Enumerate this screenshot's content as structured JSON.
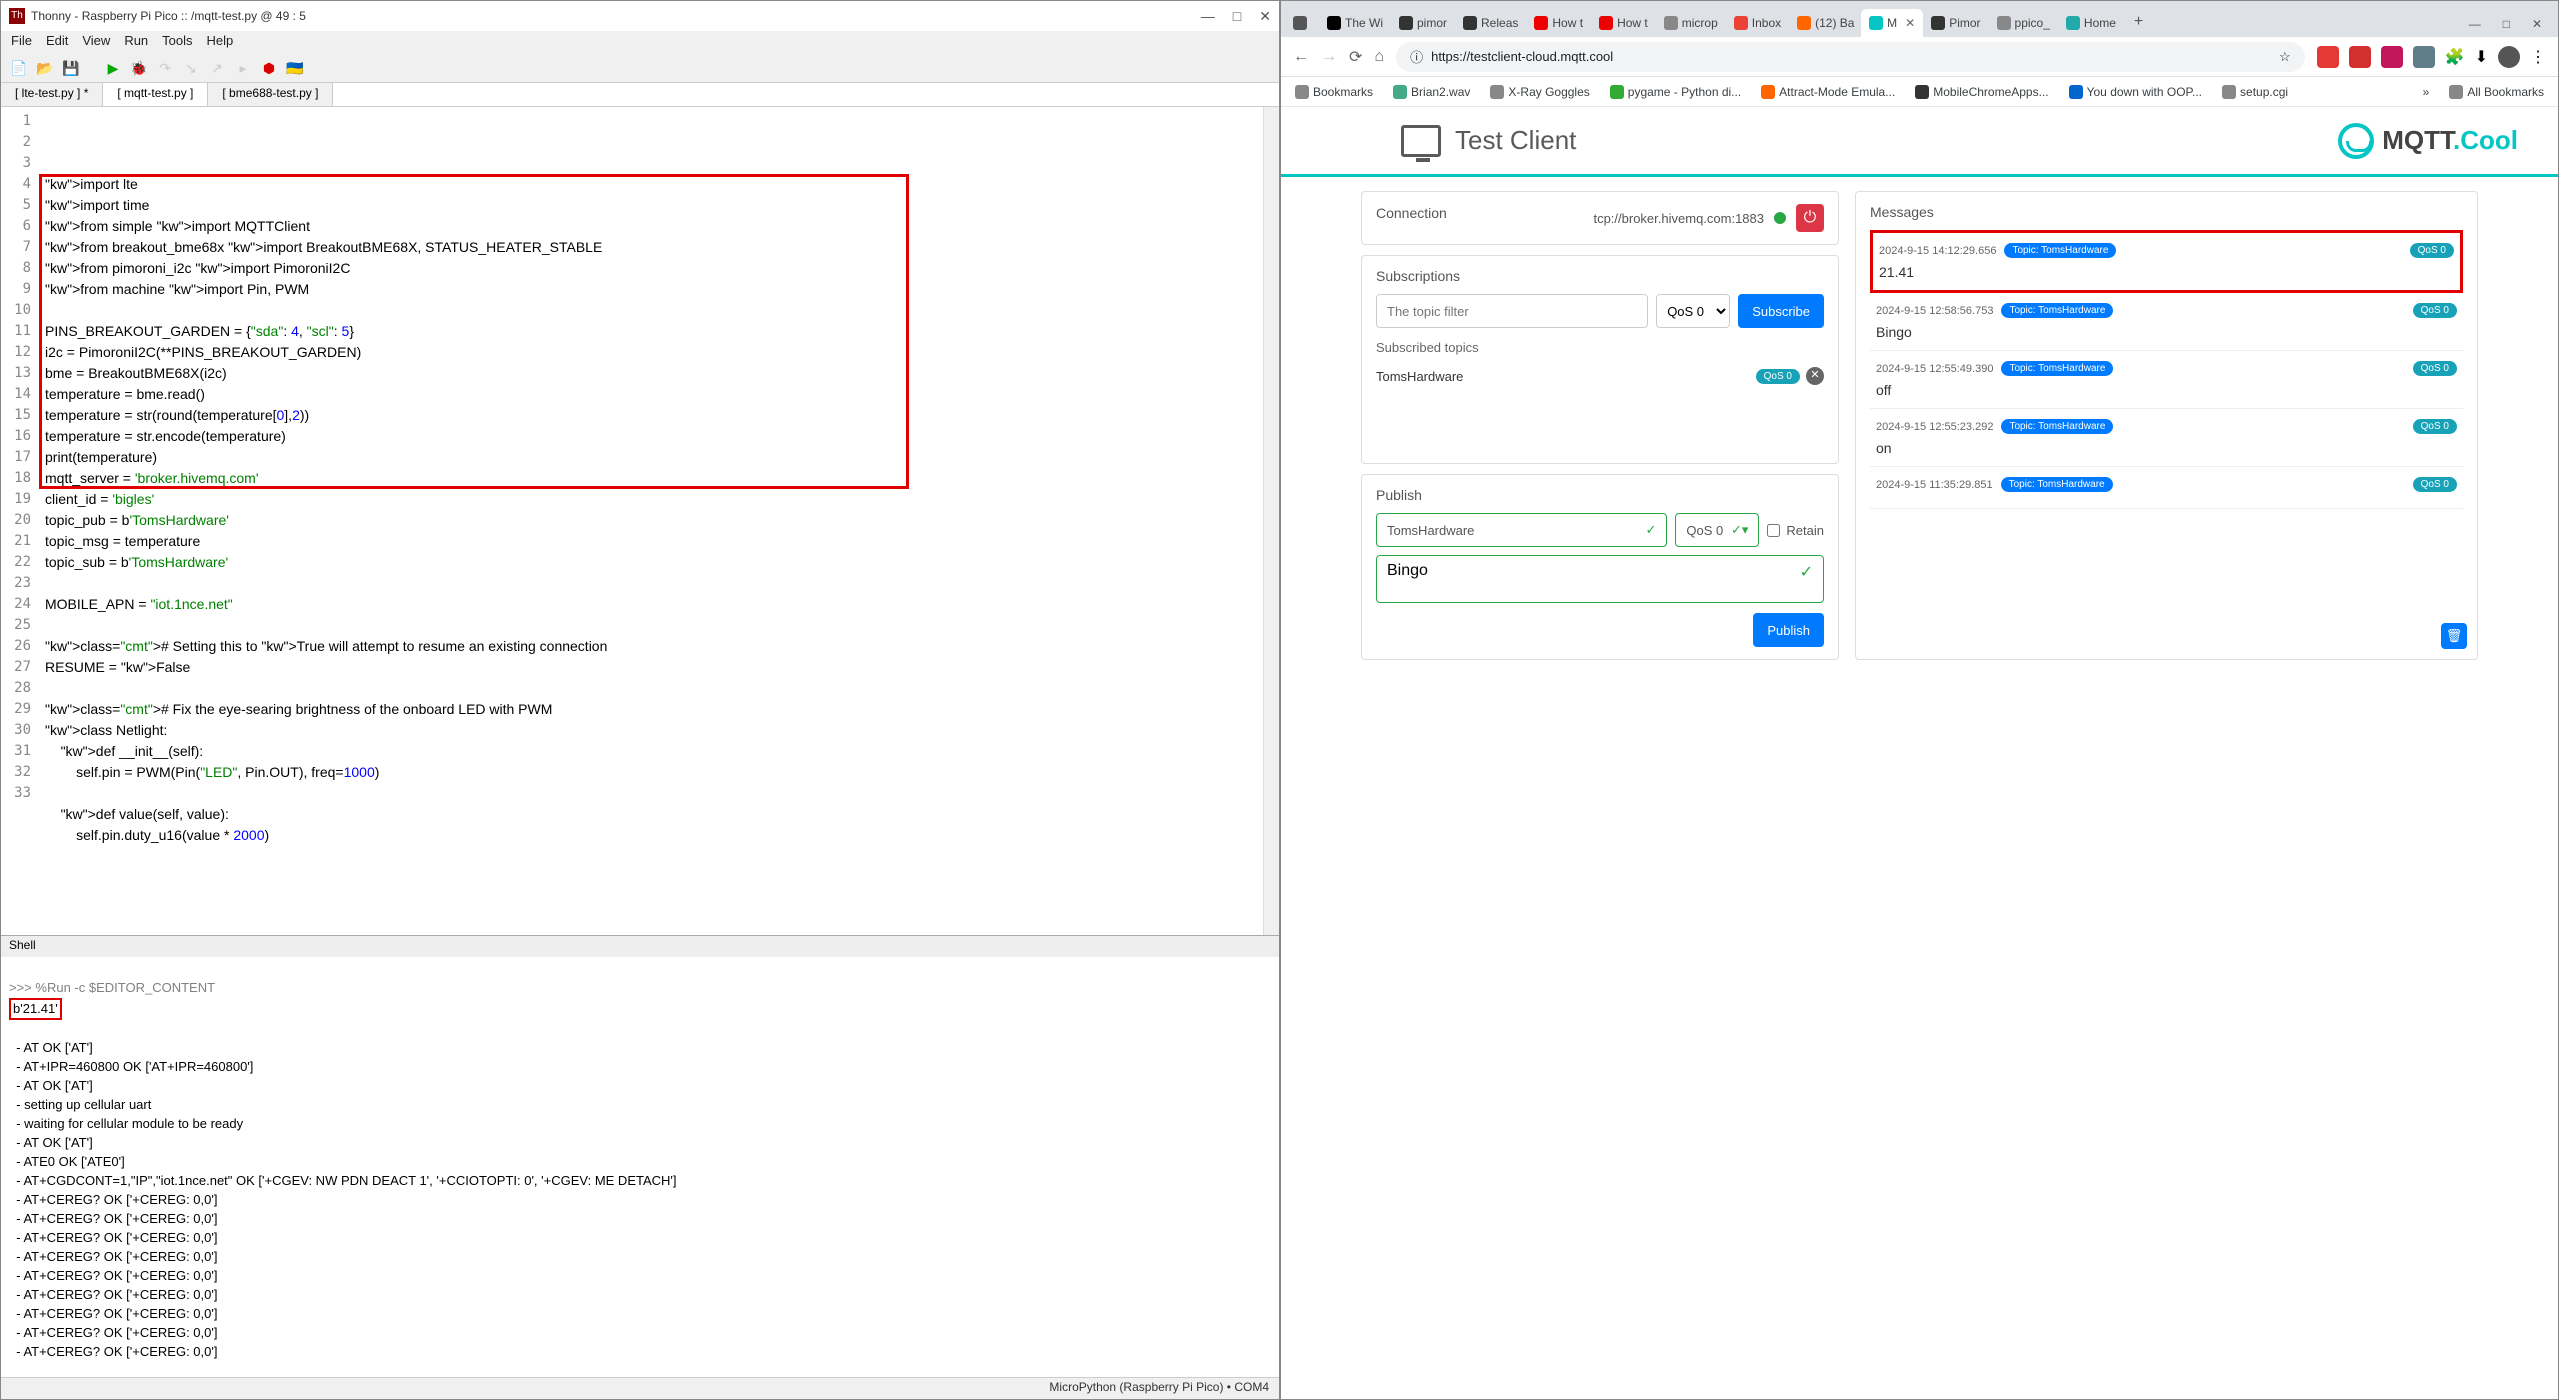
{
  "thonny": {
    "title": "Thonny  -  Raspberry Pi Pico :: /mqtt-test.py  @  49 : 5",
    "menu": [
      "File",
      "Edit",
      "View",
      "Run",
      "Tools",
      "Help"
    ],
    "tabs": [
      "[ lte-test.py ] *",
      "[ mqtt-test.py ]",
      "[ bme688-test.py ]"
    ],
    "active_tab": 1,
    "code_lines": [
      {
        "n": 1,
        "raw": "import lte"
      },
      {
        "n": 2,
        "raw": "import time"
      },
      {
        "n": 3,
        "raw": "from simple import MQTTClient"
      },
      {
        "n": 4,
        "raw": "from breakout_bme68x import BreakoutBME68X, STATUS_HEATER_STABLE"
      },
      {
        "n": 5,
        "raw": "from pimoroni_i2c import PimoroniI2C"
      },
      {
        "n": 6,
        "raw": "from machine import Pin, PWM"
      },
      {
        "n": 7,
        "raw": ""
      },
      {
        "n": 8,
        "raw": "PINS_BREAKOUT_GARDEN = {\"sda\": 4, \"scl\": 5}"
      },
      {
        "n": 9,
        "raw": "i2c = PimoroniI2C(**PINS_BREAKOUT_GARDEN)"
      },
      {
        "n": 10,
        "raw": "bme = BreakoutBME68X(i2c)"
      },
      {
        "n": 11,
        "raw": "temperature = bme.read()"
      },
      {
        "n": 12,
        "raw": "temperature = str(round(temperature[0],2))"
      },
      {
        "n": 13,
        "raw": "temperature = str.encode(temperature)"
      },
      {
        "n": 14,
        "raw": "print(temperature)"
      },
      {
        "n": 15,
        "raw": "mqtt_server = 'broker.hivemq.com'"
      },
      {
        "n": 16,
        "raw": "client_id = 'bigles'"
      },
      {
        "n": 17,
        "raw": "topic_pub = b'TomsHardware'"
      },
      {
        "n": 18,
        "raw": "topic_msg = temperature"
      },
      {
        "n": 19,
        "raw": "topic_sub = b'TomsHardware'"
      },
      {
        "n": 20,
        "raw": ""
      },
      {
        "n": 21,
        "raw": "MOBILE_APN = \"iot.1nce.net\""
      },
      {
        "n": 22,
        "raw": ""
      },
      {
        "n": 23,
        "raw": "# Setting this to True will attempt to resume an existing connection"
      },
      {
        "n": 24,
        "raw": "RESUME = False"
      },
      {
        "n": 25,
        "raw": ""
      },
      {
        "n": 26,
        "raw": "# Fix the eye-searing brightness of the onboard LED with PWM"
      },
      {
        "n": 27,
        "raw": "class Netlight:"
      },
      {
        "n": 28,
        "raw": "    def __init__(self):"
      },
      {
        "n": 29,
        "raw": "        self.pin = PWM(Pin(\"LED\", Pin.OUT), freq=1000)"
      },
      {
        "n": 30,
        "raw": ""
      },
      {
        "n": 31,
        "raw": "    def value(self, value):"
      },
      {
        "n": 32,
        "raw": "        self.pin.duty_u16(value * 2000)"
      },
      {
        "n": 33,
        "raw": ""
      }
    ],
    "highlight_code": {
      "top_line": 4,
      "bottom_line": 18
    },
    "shell_label": "Shell",
    "shell_prompt": ">>> ",
    "shell_cmd": "%Run -c $EDITOR_CONTENT",
    "shell_highlight": "b'21.41'",
    "shell_lines": [
      "  - AT OK ['AT']",
      "  - AT+IPR=460800 OK ['AT+IPR=460800']",
      "  - AT OK ['AT']",
      "  - setting up cellular uart",
      "  - waiting for cellular module to be ready",
      "  - AT OK ['AT']",
      "  - ATE0 OK ['ATE0']",
      "  - AT+CGDCONT=1,\"IP\",\"iot.1nce.net\" OK ['+CGEV: NW PDN DEACT 1', '+CCIOTOPTI: 0', '+CGEV: ME DETACH']",
      "  - AT+CEREG? OK ['+CEREG: 0,0']",
      "  - AT+CEREG? OK ['+CEREG: 0,0']",
      "  - AT+CEREG? OK ['+CEREG: 0,0']",
      "  - AT+CEREG? OK ['+CEREG: 0,0']",
      "  - AT+CEREG? OK ['+CEREG: 0,0']",
      "  - AT+CEREG? OK ['+CEREG: 0,0']",
      "  - AT+CEREG? OK ['+CEREG: 0,0']",
      "  - AT+CEREG? OK ['+CEREG: 0,0']",
      "  - AT+CEREG? OK ['+CEREG: 0,0']"
    ],
    "status": "MicroPython (Raspberry Pi Pico)  •  COM4"
  },
  "chrome": {
    "tabs": [
      {
        "label": "",
        "fav": "#555"
      },
      {
        "label": "The Wi",
        "fav": "#000"
      },
      {
        "label": "pimor",
        "fav": "#333"
      },
      {
        "label": "Releas",
        "fav": "#333"
      },
      {
        "label": "How t",
        "fav": "#e00"
      },
      {
        "label": "How t",
        "fav": "#e00"
      },
      {
        "label": "microp",
        "fav": "#888"
      },
      {
        "label": "Inbox",
        "fav": "#ea4335"
      },
      {
        "label": "(12) Ba",
        "fav": "#ff6600"
      },
      {
        "label": "M",
        "fav": "#06c5c5",
        "active": true
      },
      {
        "label": "Pimor",
        "fav": "#333"
      },
      {
        "label": "ppico_",
        "fav": "#888"
      },
      {
        "label": "Home",
        "fav": "#2aa"
      }
    ],
    "new_tab": "+",
    "url": "https://testclient-cloud.mqtt.cool",
    "bookmarks": [
      {
        "label": "Bookmarks",
        "fav": "#888"
      },
      {
        "label": "Brian2.wav",
        "fav": "#4a8"
      },
      {
        "label": "X-Ray Goggles",
        "fav": "#888"
      },
      {
        "label": "pygame - Python di...",
        "fav": "#3a3"
      },
      {
        "label": "Attract-Mode Emula...",
        "fav": "#f60"
      },
      {
        "label": "MobileChromeApps...",
        "fav": "#333"
      },
      {
        "label": "You down with OOP...",
        "fav": "#06c"
      },
      {
        "label": "setup.cgi",
        "fav": "#888"
      }
    ],
    "all_bookmarks": "All Bookmarks"
  },
  "testclient": {
    "title": "Test Client",
    "brand": "MQTT.Cool",
    "connection": {
      "heading": "Connection",
      "url": "tcp://broker.hivemq.com:1883"
    },
    "subscriptions": {
      "heading": "Subscriptions",
      "filter_placeholder": "The topic filter",
      "qos_label": "QoS 0",
      "subscribe_btn": "Subscribe",
      "subscribed_heading": "Subscribed topics",
      "topics": [
        {
          "name": "TomsHardware",
          "qos": "QoS 0"
        }
      ]
    },
    "publish": {
      "heading": "Publish",
      "topic": "TomsHardware",
      "qos": "QoS 0",
      "retain": "Retain",
      "message": "Bingo",
      "publish_btn": "Publish"
    },
    "messages": {
      "heading": "Messages",
      "items": [
        {
          "ts": "2024-9-15 14:12:29.656",
          "topic": "Topic: TomsHardware",
          "qos": "QoS 0",
          "body": "21.41",
          "hl": true
        },
        {
          "ts": "2024-9-15 12:58:56.753",
          "topic": "Topic: TomsHardware",
          "qos": "QoS 0",
          "body": "Bingo"
        },
        {
          "ts": "2024-9-15 12:55:49.390",
          "topic": "Topic: TomsHardware",
          "qos": "QoS 0",
          "body": "off"
        },
        {
          "ts": "2024-9-15 12:55:23.292",
          "topic": "Topic: TomsHardware",
          "qos": "QoS 0",
          "body": "on"
        },
        {
          "ts": "2024-9-15 11:35:29.851",
          "topic": "Topic: TomsHardware",
          "qos": "QoS 0",
          "body": ""
        }
      ]
    }
  }
}
